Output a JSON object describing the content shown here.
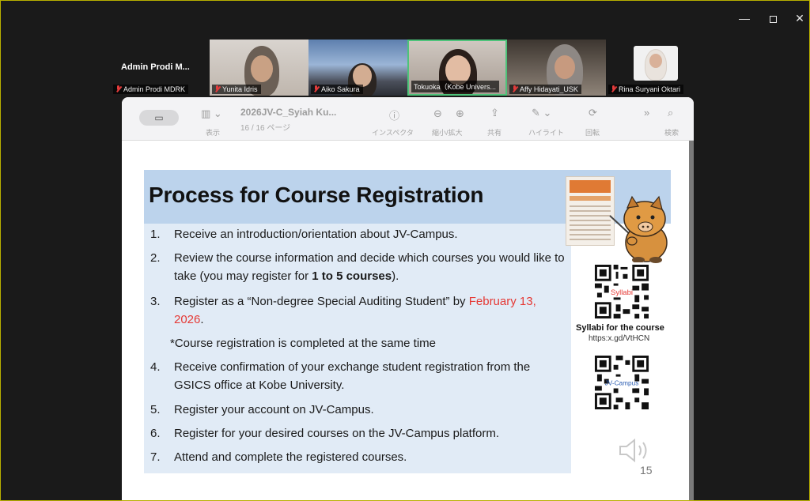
{
  "window_controls": {
    "minimize": "—",
    "close": "✕"
  },
  "participants": {
    "name_only": {
      "name": "Admin Prodi M...",
      "label": "Admin Prodi MDRK"
    },
    "tiles": [
      {
        "label": "Yunita Idris",
        "muted": true
      },
      {
        "label": "Aiko Sakura",
        "muted": true
      },
      {
        "label": "Tokuoka（Kobe Univers...",
        "muted": false,
        "active": true
      },
      {
        "label": "Affy Hidayati_USK",
        "muted": true
      },
      {
        "label": "Rina Suryani Oktari",
        "muted": true
      }
    ]
  },
  "viewer": {
    "doc_title": "2026JV-C_Syiah Ku...",
    "pages": "16 / 16 ページ",
    "toolbar": {
      "view": "表示",
      "inspector": "インスペクタ",
      "zoom": "縮小/拡大",
      "share": "共有",
      "highlight": "ハイライト",
      "rotate": "回転",
      "search": "検索"
    }
  },
  "slide": {
    "title": "Process for Course Registration",
    "steps": [
      {
        "num": "1.",
        "text": "Receive an introduction/orientation about JV-Campus."
      },
      {
        "num": "2.",
        "text_a": "Review the course information and decide which courses you would like to take (you may register for ",
        "text_bold": "1 to 5 courses",
        "text_b": ")."
      },
      {
        "num": "3.",
        "text_a": "Register as a “Non-degree Special Auditing Student” by ",
        "text_red": "February 13, 2026",
        "text_b": "."
      },
      {
        "num": "4.",
        "text": "Receive confirmation of your exchange student registration from the GSICS office at Kobe University."
      },
      {
        "num": "5.",
        "text": "Register your account on JV-Campus."
      },
      {
        "num": "6.",
        "text": "Register for your desired courses on the JV-Campus platform."
      },
      {
        "num": "7.",
        "text": "Attend and complete the registered courses."
      }
    ],
    "note": "*Course registration is completed at the same time",
    "qr1": {
      "caption": "Syllabi for the course",
      "url": "https:x.gd/VtHCN",
      "overlay": "Syllabi"
    },
    "qr2": {
      "overlay": "JV-Campus"
    },
    "page_number": "15"
  },
  "colors": {
    "accent_red": "#e53935",
    "title_band": "#bcd3ec",
    "content_box": "#e1ebf6",
    "active_speaker": "#4ec37a"
  }
}
